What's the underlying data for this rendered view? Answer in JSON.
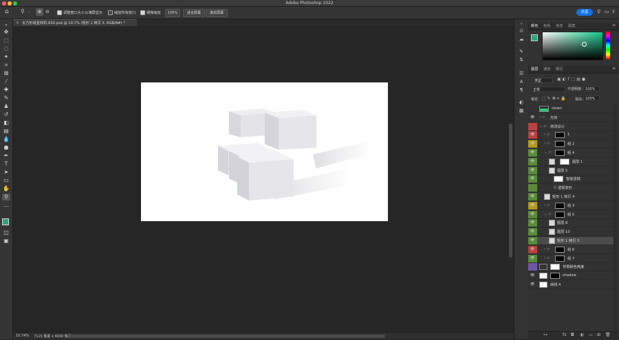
{
  "app": {
    "window_title": "Adobe Photoshop 2022",
    "share_label": "共享"
  },
  "colors": {
    "accent": "#1473e6",
    "red": "#b8423f",
    "yellow": "#b39b1e",
    "green": "#5b8a3a",
    "purple": "#6f56a6",
    "fg": "#2fa37a",
    "fg_color": "#2fa37a"
  },
  "options": {
    "resize_windows": "调整窗口大小以满屏显示",
    "zoom_all": "缩放所有窗口",
    "scrubby_zoom": "细微缩放",
    "zoom_value": "100%",
    "fit_screen": "适合屏幕",
    "fill_screen": "填充屏幕"
  },
  "document": {
    "tab_title": "长方形纸盒样机.630.psd @ 10.7% (矩形 1 拷贝 3, RGB/8#) *",
    "zoom": "10.74%",
    "size_info": "7115 像素 x 4000 像素 (72 ppi)"
  },
  "color_panel": {
    "tabs": [
      "颜色",
      "色板",
      "渐变",
      "图案"
    ]
  },
  "layers_panel": {
    "tabs": [
      "图层",
      "通道",
      "路径"
    ],
    "filter_kind": "类型",
    "blend_mode": "正常",
    "opacity_label": "不透明度:",
    "opacity": "100%",
    "lock_label": "锁定:",
    "fill_label": "填充:",
    "fill": "100%",
    "layers": [
      {
        "name": "clown",
        "eye": false,
        "color": "",
        "indent": 0,
        "kind": "thumb-color"
      },
      {
        "name": "光效",
        "eye": true,
        "color": "",
        "indent": 0,
        "kind": "folder-closed"
      },
      {
        "name": "修改设计",
        "eye": false,
        "color": "red",
        "indent": 0,
        "kind": "folder-open"
      },
      {
        "name": "1",
        "eye": true,
        "color": "red",
        "indent": 1,
        "kind": "folder-mask"
      },
      {
        "name": "组 2",
        "eye": true,
        "color": "yellow",
        "indent": 1,
        "kind": "folder-mask"
      },
      {
        "name": "组 4",
        "eye": true,
        "color": "green",
        "indent": 1,
        "kind": "folder-open-mask"
      },
      {
        "name": "图层 1",
        "eye": true,
        "color": "green",
        "indent": 2,
        "kind": "smart-mask"
      },
      {
        "name": "图层 5",
        "eye": true,
        "color": "green",
        "indent": 2,
        "kind": "smart"
      },
      {
        "name": "智能滤镜",
        "eye": true,
        "color": "green",
        "indent": 3,
        "kind": "filter"
      },
      {
        "name": "透视变形",
        "eye": false,
        "color": "green",
        "indent": 3,
        "kind": "sub"
      },
      {
        "name": "矩形 1 拷贝 4",
        "eye": true,
        "color": "green",
        "indent": 1,
        "kind": "smart"
      },
      {
        "name": "组 3",
        "eye": true,
        "color": "yellow",
        "indent": 1,
        "kind": "folder-mask"
      },
      {
        "name": "组 5",
        "eye": true,
        "color": "green",
        "indent": 1,
        "kind": "folder-open-mask"
      },
      {
        "name": "图层 8",
        "eye": true,
        "color": "green",
        "indent": 2,
        "kind": "smart"
      },
      {
        "name": "图层 10",
        "eye": true,
        "color": "green",
        "indent": 2,
        "kind": "smart"
      },
      {
        "name": "矩形 1 拷贝 3",
        "eye": true,
        "color": "green",
        "indent": 2,
        "kind": "smart",
        "selected": true
      },
      {
        "name": "组 6",
        "eye": true,
        "color": "red",
        "indent": 1,
        "kind": "folder-mask"
      },
      {
        "name": "组 7",
        "eye": true,
        "color": "green",
        "indent": 1,
        "kind": "folder-mask"
      },
      {
        "name": "背景颜色亮度",
        "eye": false,
        "color": "purple",
        "indent": 0,
        "kind": "adjust-mask"
      },
      {
        "name": "shadow",
        "eye": true,
        "color": "",
        "indent": 0,
        "kind": "white-mask"
      },
      {
        "name": "曲线 4",
        "eye": true,
        "color": "",
        "indent": 0,
        "kind": "curves"
      }
    ]
  }
}
